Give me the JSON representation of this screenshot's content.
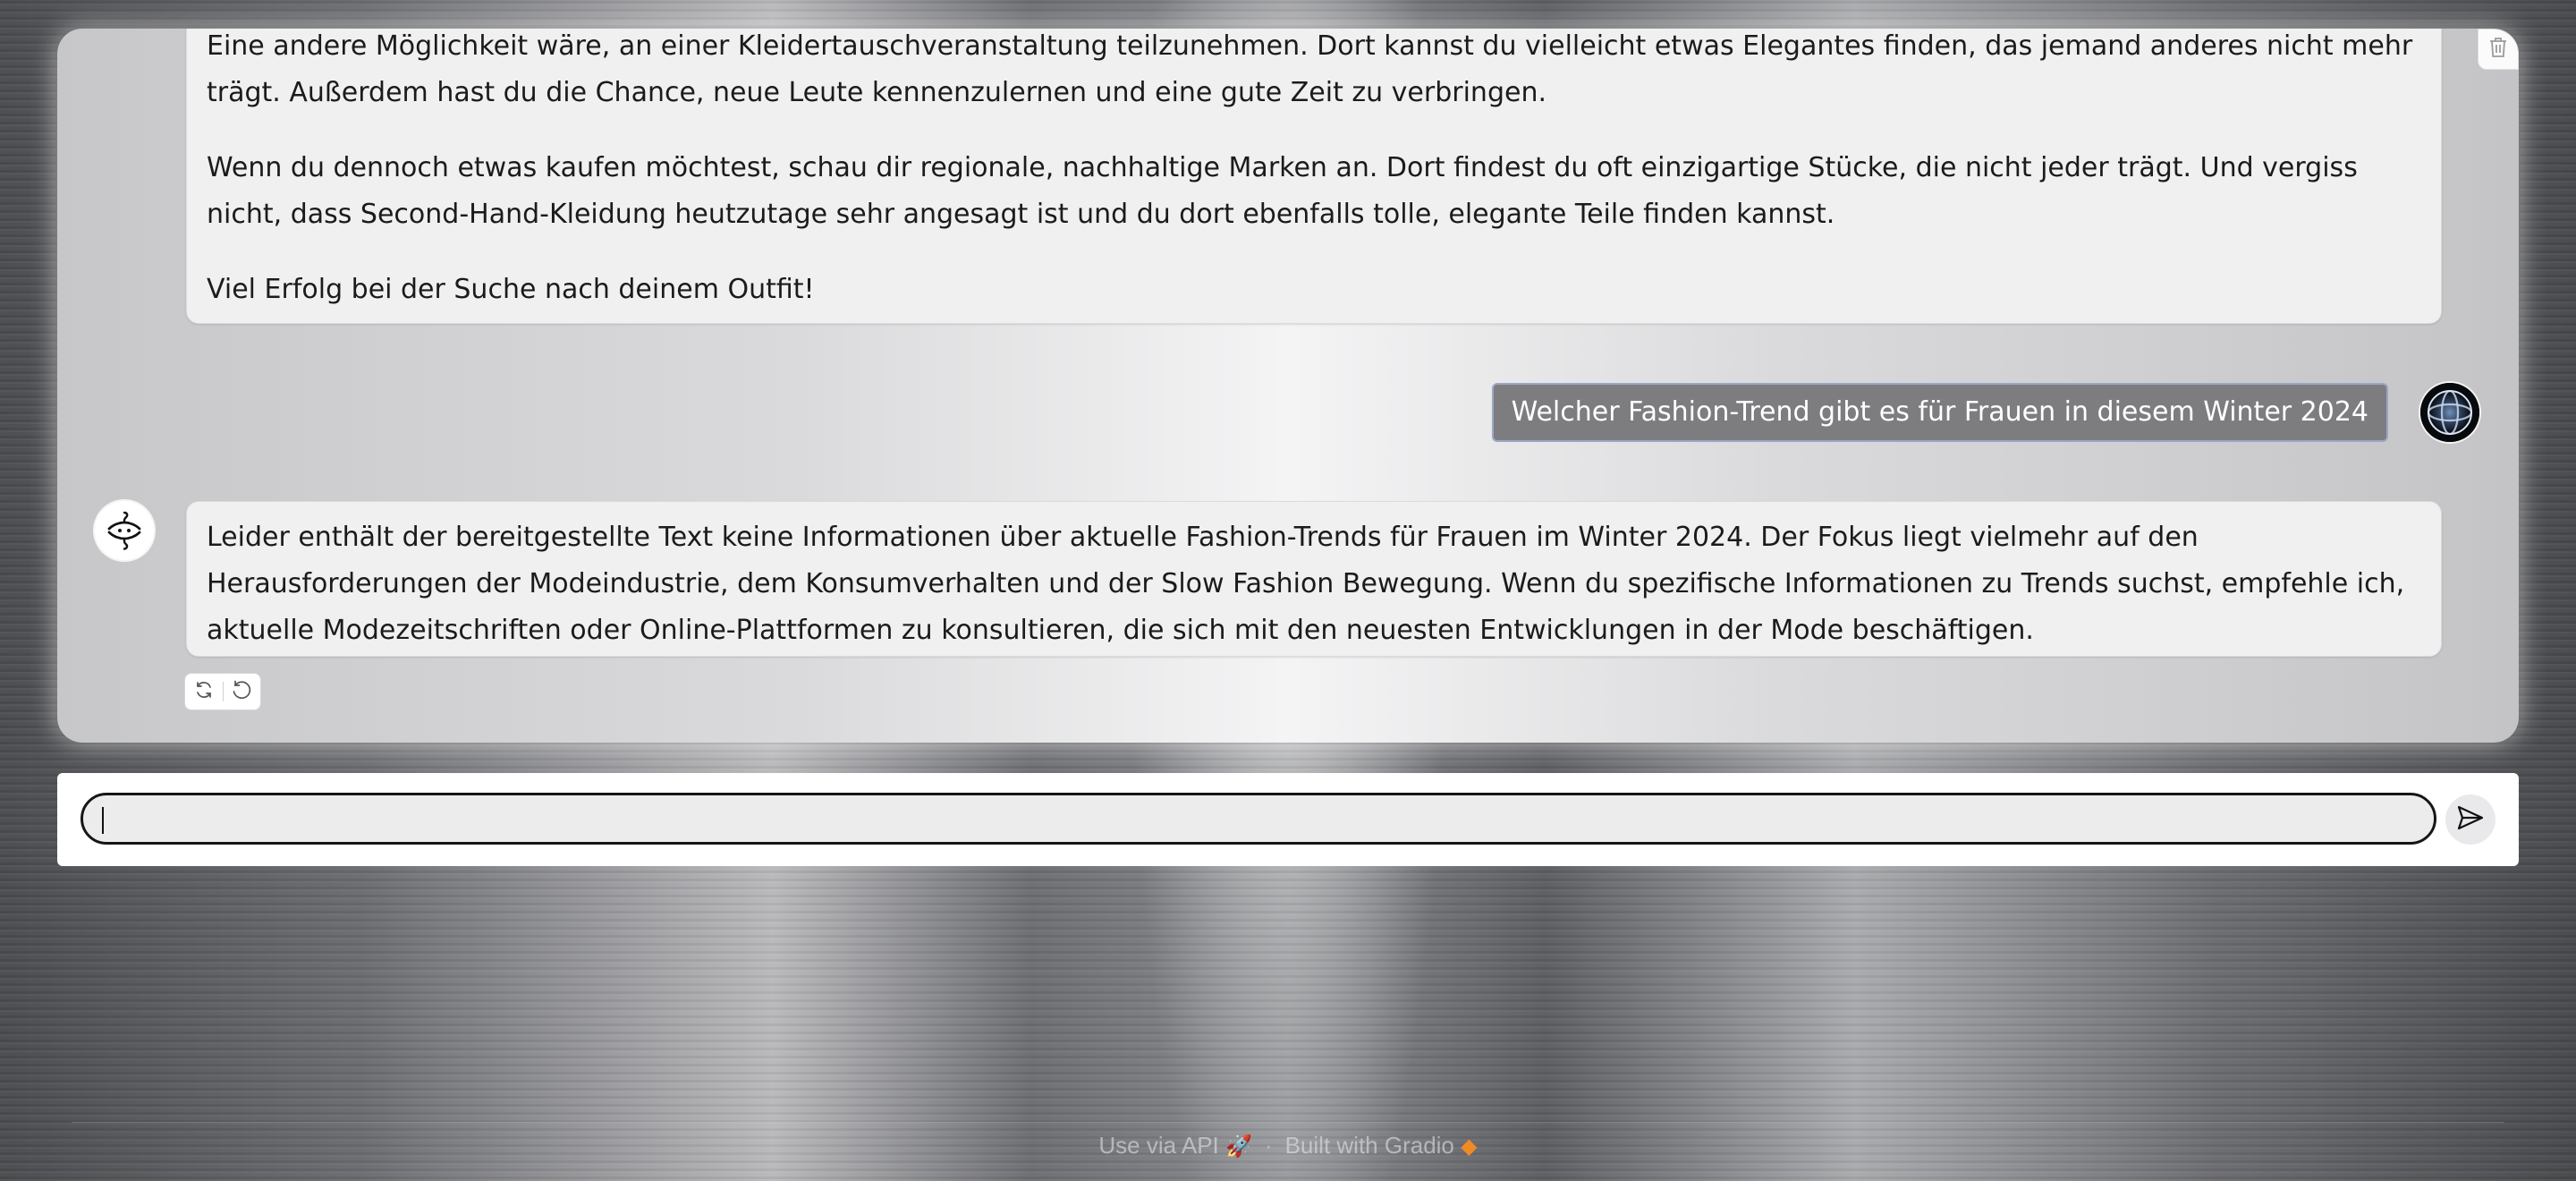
{
  "chat": {
    "messages": [
      {
        "role": "assistant",
        "paragraphs": [
          "Eine andere Möglichkeit wäre, an einer Kleidertauschveranstaltung teilzunehmen. Dort kannst du vielleicht etwas Elegantes finden, das jemand anderes nicht mehr trägt. Außerdem hast du die Chance, neue Leute kennenzulernen und eine gute Zeit zu verbringen.",
          "Wenn du dennoch etwas kaufen möchtest, schau dir regionale, nachhaltige Marken an. Dort findest du oft einzigartige Stücke, die nicht jeder trägt. Und vergiss nicht, dass Second-Hand-Kleidung heutzutage sehr angesagt ist und du dort ebenfalls tolle, elegante Teile finden kannst.",
          "Viel Erfolg bei der Suche nach deinem Outfit!"
        ]
      },
      {
        "role": "user",
        "text": "Welcher Fashion-Trend gibt es für Frauen in diesem Winter 2024"
      },
      {
        "role": "assistant",
        "paragraphs": [
          "Leider enthält der bereitgestellte Text keine Informationen über aktuelle Fashion-Trends für Frauen im Winter 2024. Der Fokus liegt vielmehr auf den Herausforderungen der Modeindustrie, dem Konsumverhalten und der Slow Fashion Bewegung. Wenn du spezifische Informationen zu Trends suchst, empfehle ich, aktuelle Modezeitschriften oder Online-Plattformen zu konsultieren, die sich mit den neuesten Entwicklungen in der Mode beschäftigen."
        ]
      }
    ],
    "icons": {
      "clear": "trash-icon",
      "retry": "refresh-icon",
      "undo": "undo-icon",
      "user_avatar": "globe-avatar",
      "bot_avatar": "hanger-logo"
    }
  },
  "composer": {
    "value": "",
    "placeholder": "",
    "send_icon": "send-icon"
  },
  "footer": {
    "api_label": "Use via API",
    "separator": "·",
    "built_label": "Built with Gradio"
  },
  "colors": {
    "user_bubble": "#7d7d80",
    "user_bubble_border": "#9aa7c4",
    "bot_bubble": "#f0f0f1",
    "input_border": "#161616"
  }
}
